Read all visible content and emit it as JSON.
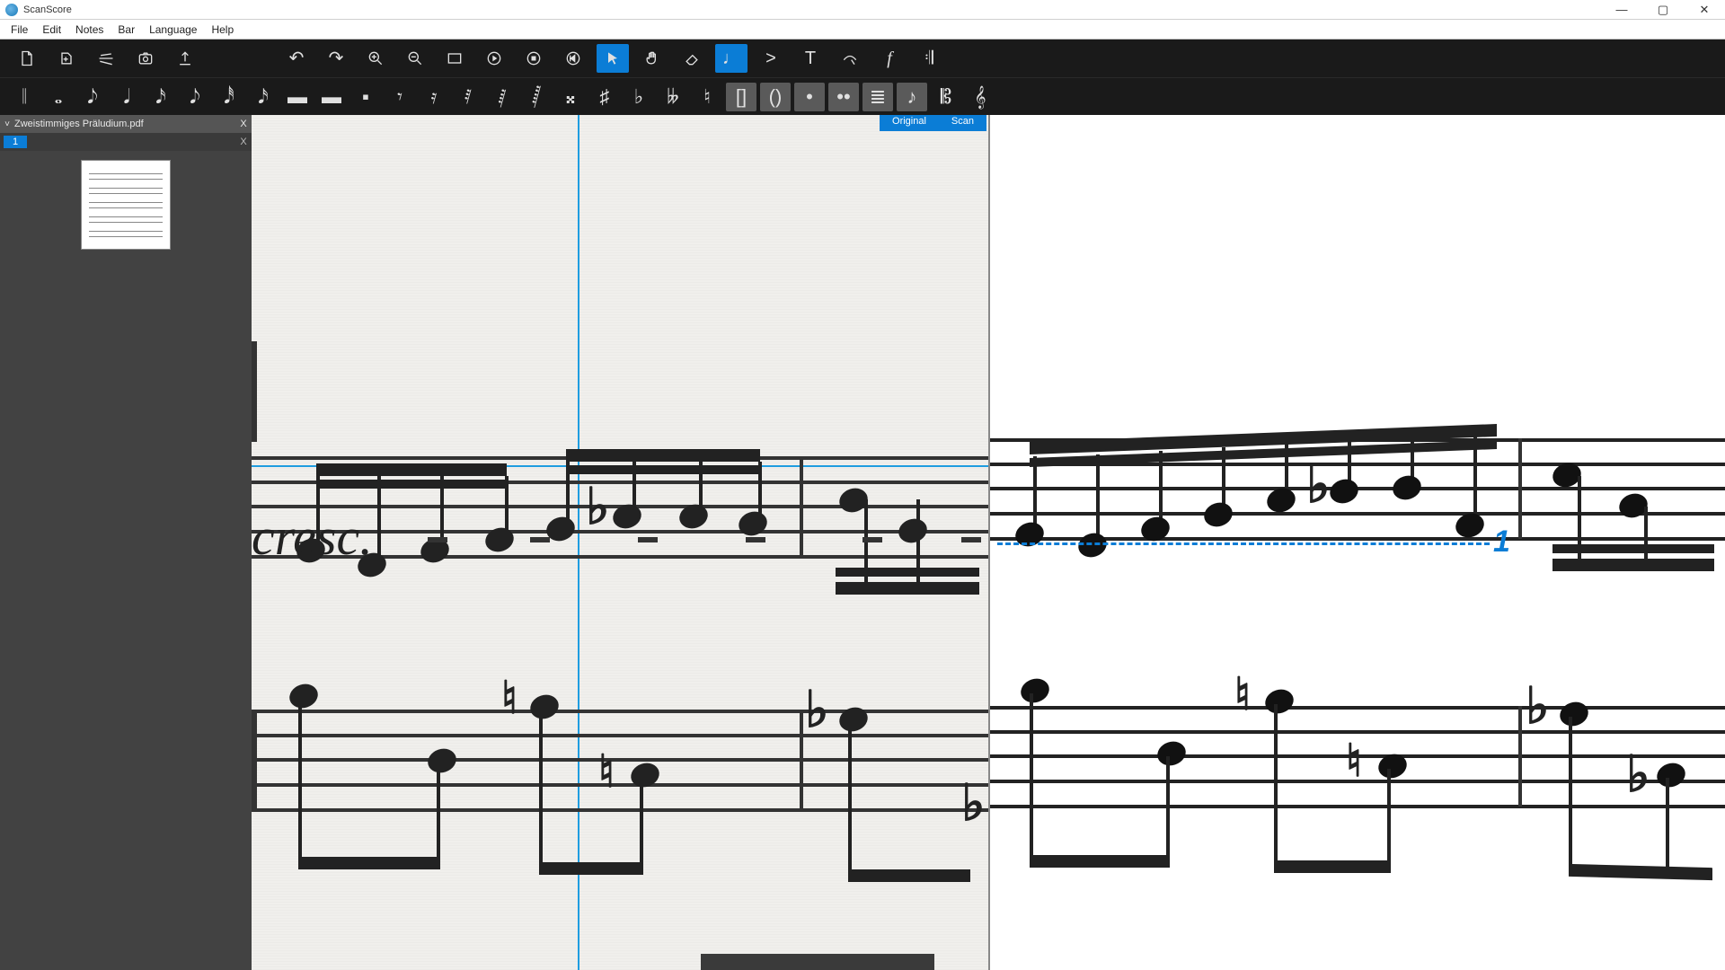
{
  "app": {
    "title": "ScanScore"
  },
  "menu": {
    "file": "File",
    "edit": "Edit",
    "notes": "Notes",
    "bar": "Bar",
    "language": "Language",
    "help": "Help"
  },
  "window": {
    "min": "—",
    "max": "▢",
    "close": "✕"
  },
  "document": {
    "name": "Zweistimmiges Präludium.pdf",
    "page": "1",
    "chevron": "˅",
    "close": "X"
  },
  "viewTabs": {
    "original": "Original",
    "scan": "Scan"
  },
  "score": {
    "cresc": "cresc.",
    "cue": "1"
  },
  "toolbar": {
    "open": "open",
    "addpage": "addpage",
    "scan": "scan",
    "camera": "camera",
    "export": "export",
    "undo": "↶",
    "redo": "↷",
    "zoomin": "+",
    "zoomout": "−",
    "fit": "fit",
    "play": "▶",
    "stop": "■",
    "begin": "⏮",
    "pointer": "↖",
    "hand": "✋",
    "erase": "◇",
    "note": "♪",
    "accent": ">",
    "text": "T",
    "slur": "𝄐",
    "dynamics": "𝆒",
    "repeat": "𝄆"
  },
  "toolbar2": {
    "bar": "𝄁",
    "wholenote": "𝅝",
    "n8": "𝅘𝅥𝅮",
    "n4": "𝅘𝅥",
    "n16": "𝅘𝅥𝅯",
    "n8b": "𝅘𝅥𝅮",
    "n32": "𝅘𝅥𝅰",
    "n16b": "𝅘𝅥𝅯",
    "rw": "▬",
    "rh": "▬",
    "rq": "▪",
    "r8": "𝄾",
    "r16": "𝄿",
    "r32": "𝅀",
    "r64": "𝅁",
    "r128": "𝅂",
    "dsharp": "𝄪",
    "sharp": "♯",
    "flat": "♭",
    "dflat": "𝄫",
    "natural": "♮",
    "braL": "[]",
    "braR": "()",
    "dot": "•",
    "ddot": "••",
    "trem": "≣",
    "grace": "♪",
    "chord": "𝄡",
    "clef": "𝄞"
  }
}
